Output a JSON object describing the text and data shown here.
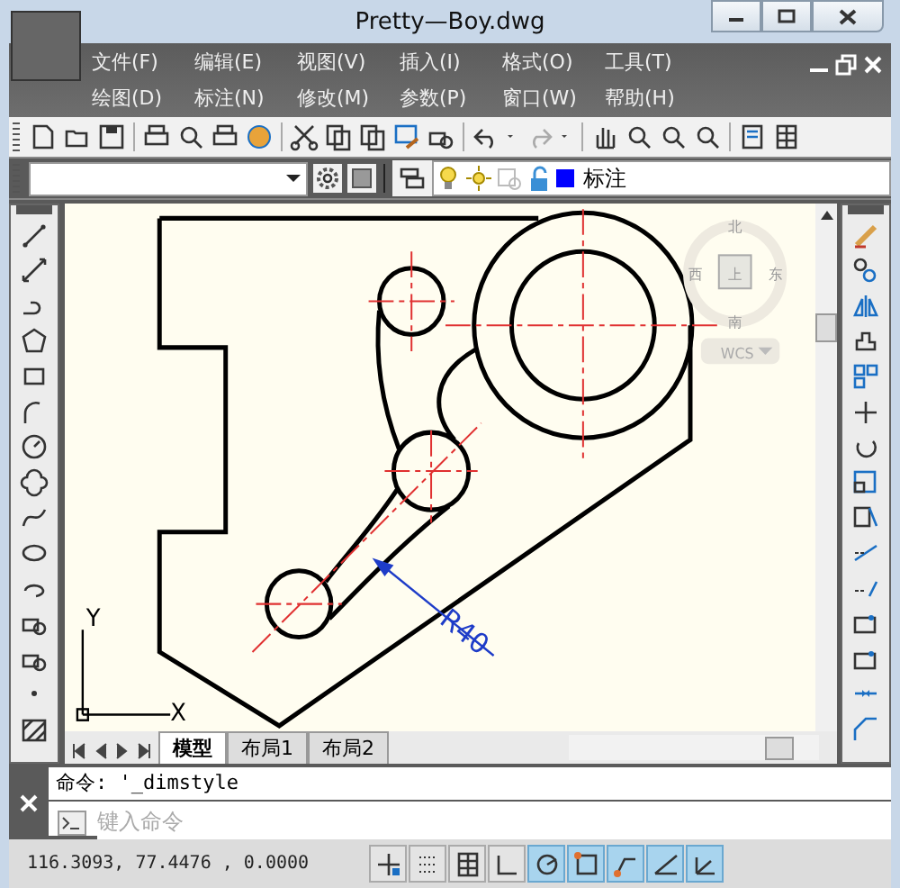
{
  "window": {
    "title": "Pretty—Boy.dwg"
  },
  "menu_rows": [
    [
      "文件(F)",
      "编辑(E)",
      "视图(V)",
      "插入(I)",
      "格式(O)",
      "工具(T)"
    ],
    [
      "绘图(D)",
      "标注(N)",
      "修改(M)",
      "参数(P)",
      "窗口(W)",
      "帮助(H)"
    ]
  ],
  "layer_toolbar": {
    "layer_name": "标注"
  },
  "viewcube": {
    "north": "北",
    "west": "西",
    "east": "东",
    "south": "南",
    "face": "上",
    "ucs": "WCS"
  },
  "drawing": {
    "dimension": "R40",
    "axis_y": "Y",
    "axis_x": "X"
  },
  "layout_tabs": [
    {
      "label": "模型",
      "selected": true
    },
    {
      "label": "布局1",
      "selected": false
    },
    {
      "label": "布局2",
      "selected": false
    }
  ],
  "command_history": "命令: '_dimstyle",
  "command_input": {
    "placeholder": "键入命令"
  },
  "status_bar": {
    "coordinates": "116.3093, 77.4476 , 0.0000",
    "toggles": [
      {
        "on": false
      },
      {
        "on": false
      },
      {
        "on": false
      },
      {
        "on": false
      },
      {
        "on": true
      },
      {
        "on": true
      },
      {
        "on": true
      },
      {
        "on": true
      },
      {
        "on": true
      }
    ]
  }
}
